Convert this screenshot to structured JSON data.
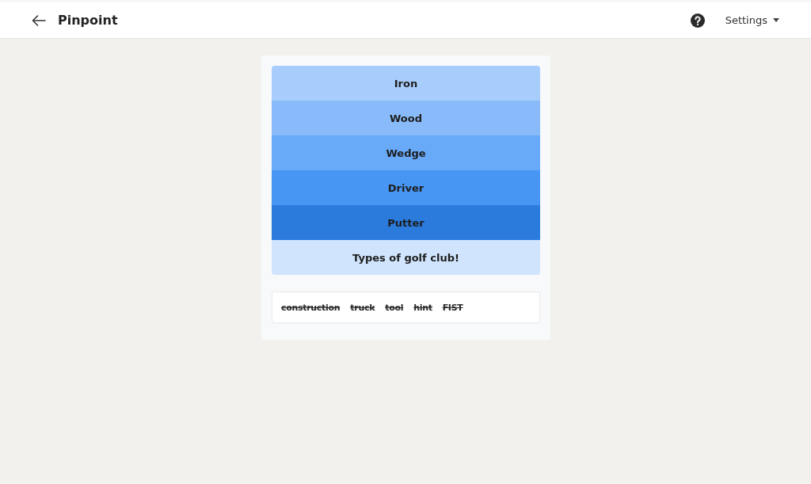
{
  "header": {
    "title": "Pinpoint",
    "settings_label": "Settings"
  },
  "clues": [
    {
      "text": "Iron",
      "color": "#a8cdfd"
    },
    {
      "text": "Wood",
      "color": "#89bbfa"
    },
    {
      "text": "Wedge",
      "color": "#68a9f8"
    },
    {
      "text": "Driver",
      "color": "#4796f3"
    },
    {
      "text": "Putter",
      "color": "#2a7bdc"
    }
  ],
  "answer": {
    "text": "Types of golf club!"
  },
  "guesses": [
    {
      "text": "construction",
      "struck": true
    },
    {
      "text": "truck",
      "struck": true
    },
    {
      "text": "tool",
      "struck": true
    },
    {
      "text": "hint",
      "struck": true
    },
    {
      "text": "FIST",
      "struck": true
    }
  ]
}
